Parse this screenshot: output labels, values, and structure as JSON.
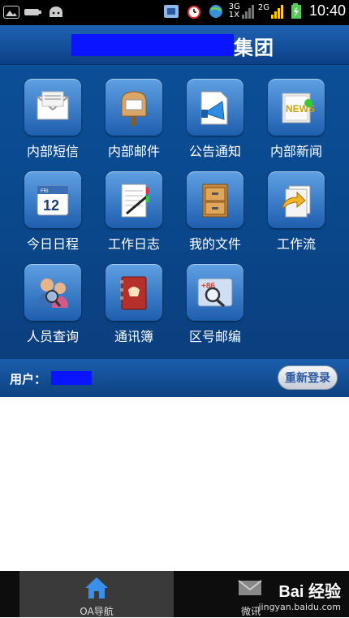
{
  "status_bar": {
    "time": "10:40",
    "network_3g": "3G",
    "network_1x": "1X",
    "network_2g": "2G"
  },
  "header": {
    "title": "集团"
  },
  "apps": [
    {
      "label": "内部短信",
      "icon": "mail-envelope-icon"
    },
    {
      "label": "内部邮件",
      "icon": "mailbox-icon"
    },
    {
      "label": "公告通知",
      "icon": "megaphone-icon"
    },
    {
      "label": "内部新闻",
      "icon": "newspaper-icon"
    },
    {
      "label": "今日日程",
      "icon": "calendar-icon"
    },
    {
      "label": "工作日志",
      "icon": "notebook-icon"
    },
    {
      "label": "我的文件",
      "icon": "file-cabinet-icon"
    },
    {
      "label": "工作流",
      "icon": "workflow-arrow-icon"
    },
    {
      "label": "人员查询",
      "icon": "people-search-icon"
    },
    {
      "label": "通讯簿",
      "icon": "address-book-icon"
    },
    {
      "label": "区号邮编",
      "icon": "area-code-search-icon"
    }
  ],
  "calendar_icon_text": {
    "weekday": "FRI",
    "day": "12"
  },
  "address_icon_text": "+86",
  "news_icon_text": "NEWS",
  "user_bar": {
    "label": "用户：",
    "relogin_label": "重新登录"
  },
  "tabs": [
    {
      "label": "OA导航",
      "icon": "home-icon",
      "active": true
    },
    {
      "label": "微讯",
      "icon": "envelope-icon",
      "active": false
    }
  ],
  "watermark": {
    "main": "Bai 经验",
    "sub": "jingyan.baidu.com"
  },
  "colors": {
    "header": "#1f63b3",
    "main_bg": "#0a4689",
    "redaction": "#0a14ff"
  }
}
